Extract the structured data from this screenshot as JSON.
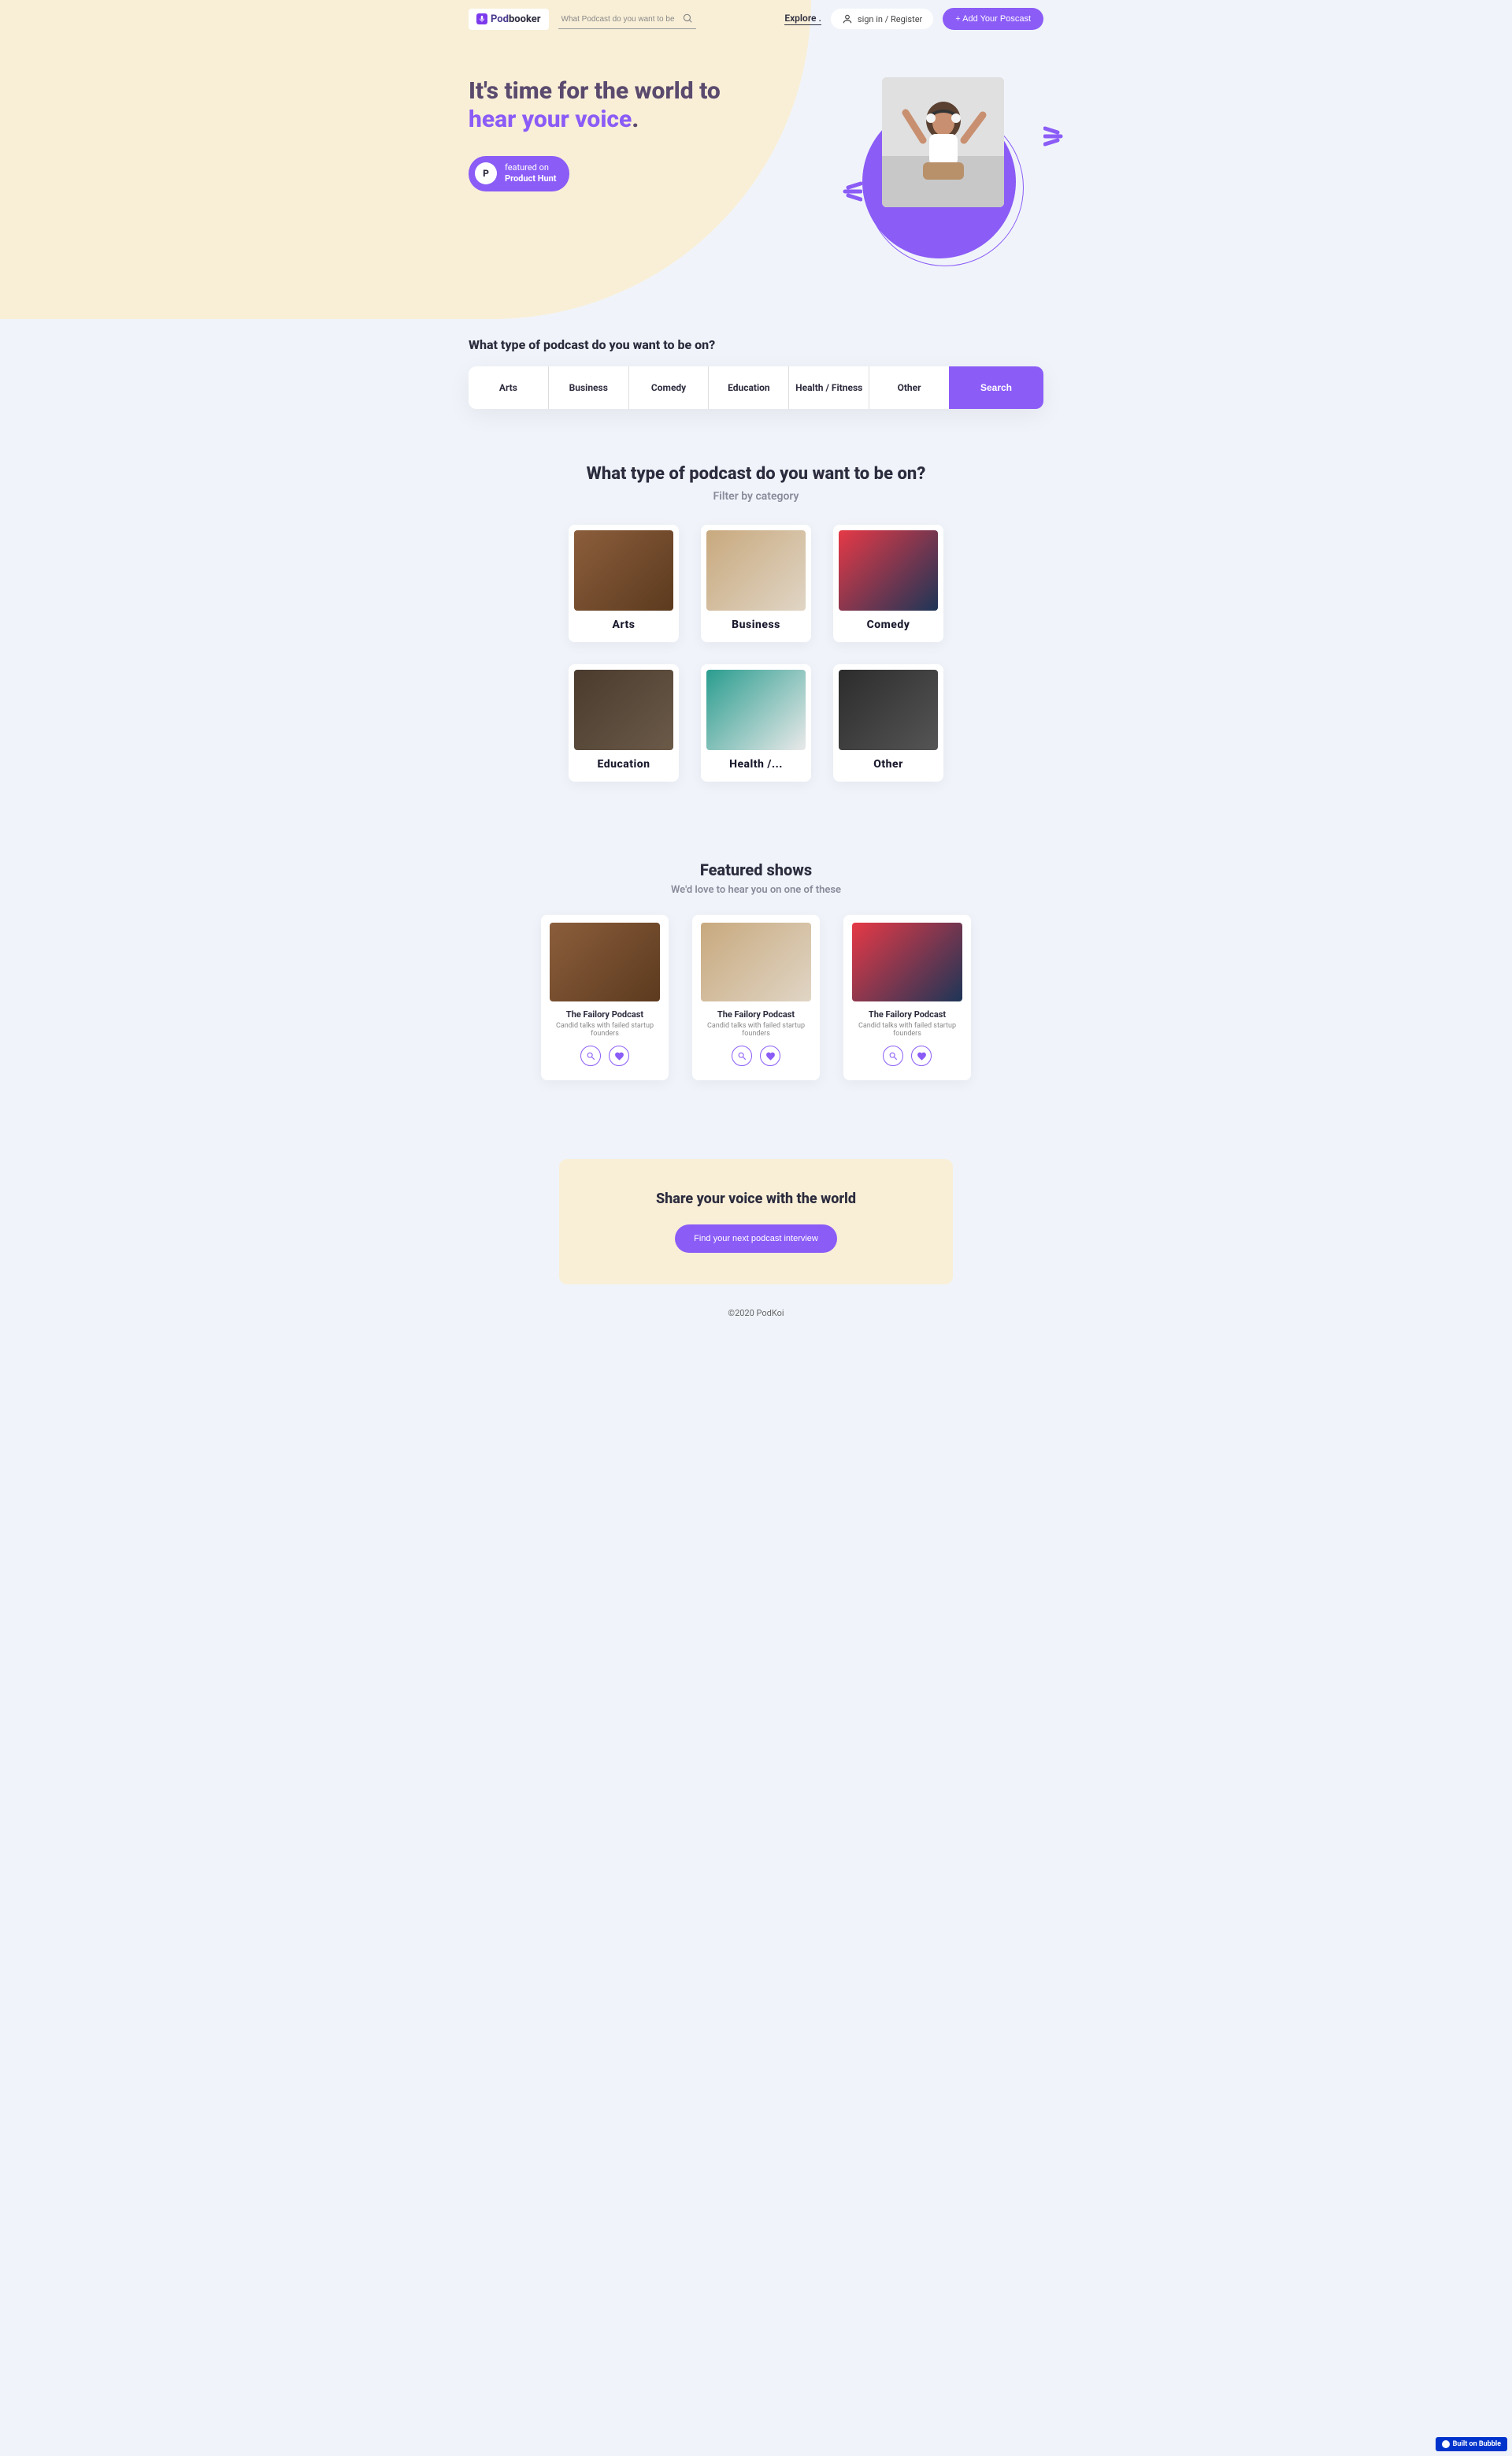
{
  "brand": {
    "name_a": "Pod",
    "name_b": "booker"
  },
  "topbar": {
    "search_placeholder": "What Podcast do you want to be on?",
    "explore": "Explore .",
    "signin": "sign in / Register",
    "add": "+ Add Your Poscast"
  },
  "hero": {
    "line1": "It's time for the world to",
    "line2": "hear your voice",
    "dot": ".",
    "ph_sub": "featured on",
    "ph_main": "Product Hunt",
    "ph_letter": "P"
  },
  "prompt": "What type of podcast do you want to be on?",
  "categories": [
    "Arts",
    "Business",
    "Comedy",
    "Education",
    "Health / Fitness",
    "Other"
  ],
  "search_btn": "Search",
  "filter_title": "What type of podcast do you want to be on?",
  "filter_sub": "Filter by category",
  "cards": [
    "Arts",
    "Business",
    "Comedy",
    "Education",
    "Health /...",
    "Other"
  ],
  "featured_title": "Featured shows",
  "featured_sub": "We'd love to hear you on one of these",
  "shows": [
    {
      "title": "The Failory Podcast",
      "desc": "Candid talks with failed startup founders"
    },
    {
      "title": "The Failory Podcast",
      "desc": "Candid talks with failed startup founders"
    },
    {
      "title": "The Failory Podcast",
      "desc": "Candid talks with failed startup founders"
    }
  ],
  "cta": {
    "title": "Share your voice with the world",
    "btn": "Find your next podcast interview"
  },
  "footer": "©2020 PodKoi",
  "bubble": "Built on Bubble"
}
